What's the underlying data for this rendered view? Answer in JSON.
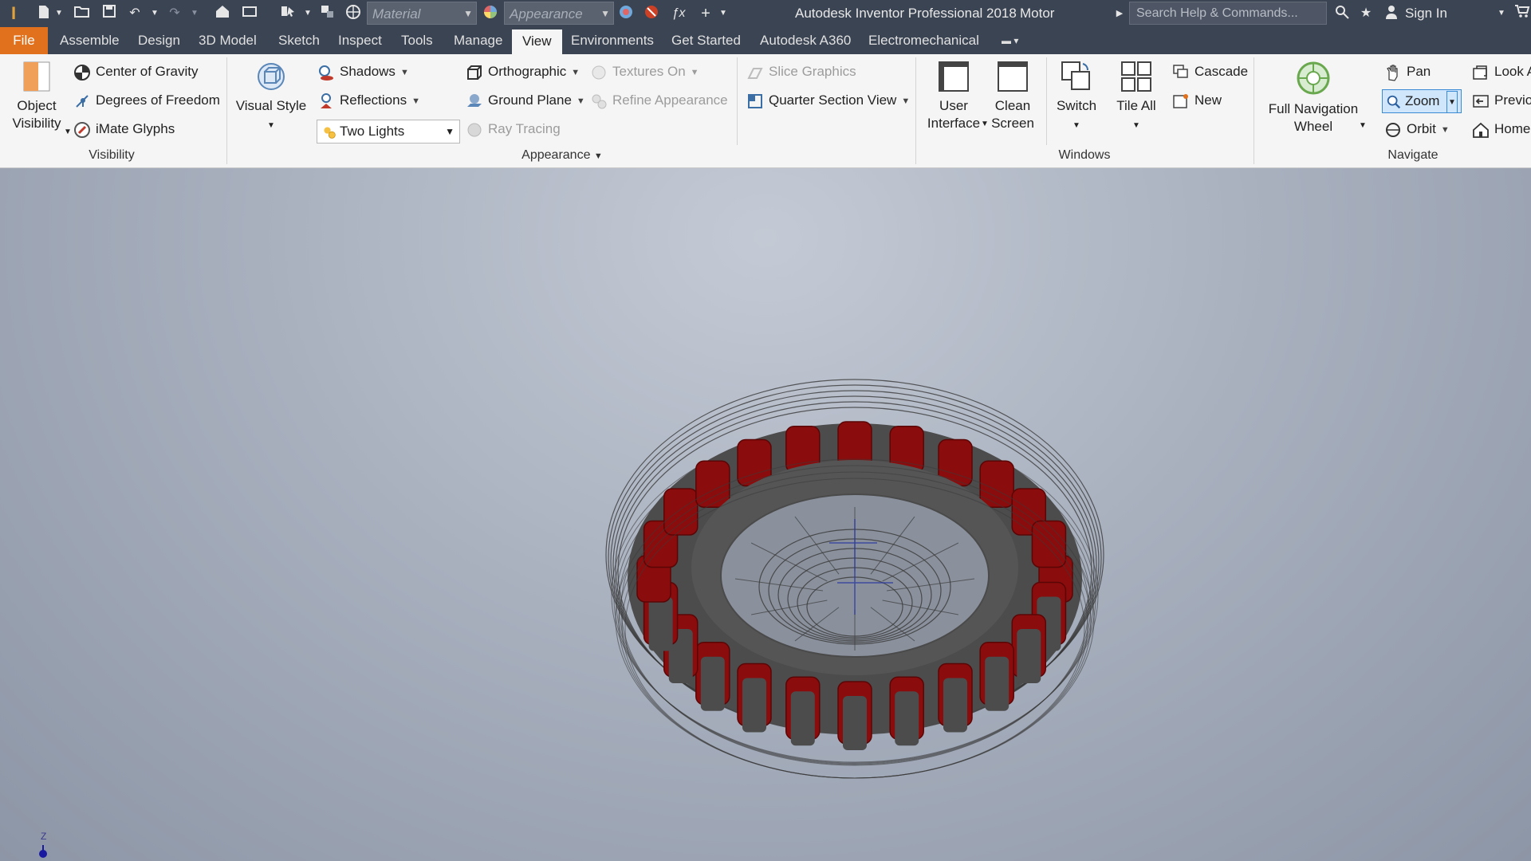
{
  "titlebar": {
    "app_title": "Autodesk Inventor Professional 2018",
    "document": "Motor",
    "material_placeholder": "Material",
    "appearance_placeholder": "Appearance",
    "search_placeholder": "Search Help & Commands...",
    "sign_in": "Sign In",
    "colors": {
      "bg": "#3b4453"
    }
  },
  "tabs": [
    {
      "label": "File"
    },
    {
      "label": "Assemble"
    },
    {
      "label": "Design"
    },
    {
      "label": "3D Model"
    },
    {
      "label": "Sketch"
    },
    {
      "label": "Inspect"
    },
    {
      "label": "Tools"
    },
    {
      "label": "Manage"
    },
    {
      "label": "View",
      "active": true
    },
    {
      "label": "Environments"
    },
    {
      "label": "Get Started"
    },
    {
      "label": "Autodesk A360"
    },
    {
      "label": "Electromechanical"
    }
  ],
  "ribbon": {
    "visibility": {
      "title": "Visibility",
      "object_visibility": [
        "Object",
        "Visibility"
      ],
      "center_of_gravity": "Center of Gravity",
      "degrees_of_freedom": "Degrees of Freedom",
      "imate_glyphs": "iMate Glyphs"
    },
    "appearance": {
      "title": "Appearance",
      "visual_style": "Visual Style",
      "shadows": "Shadows",
      "reflections": "Reflections",
      "lights": "Two Lights",
      "orthographic": "Orthographic",
      "ground_plane": "Ground Plane",
      "ray_tracing": "Ray Tracing",
      "textures_on": "Textures On",
      "refine_appearance": "Refine Appearance",
      "slice_graphics": "Slice Graphics",
      "quarter_section_view": "Quarter Section View"
    },
    "windows": {
      "title": "Windows",
      "user_interface": [
        "User",
        "Interface"
      ],
      "clean_screen": [
        "Clean",
        "Screen"
      ],
      "switch": "Switch",
      "tile_all": "Tile All",
      "cascade": "Cascade",
      "new": "New"
    },
    "navigate": {
      "title": "Navigate",
      "full_navigation_wheel": [
        "Full Navigation",
        "Wheel"
      ],
      "pan": "Pan",
      "zoom": "Zoom",
      "orbit": "Orbit",
      "look": "Look A",
      "previous": "Previo",
      "home": "Home"
    }
  },
  "viewport": {
    "axis_label": "Z",
    "colors": {
      "coil": "#8b0c0c",
      "core": "#4c4c4c",
      "wire": "#3a3a3a"
    }
  }
}
